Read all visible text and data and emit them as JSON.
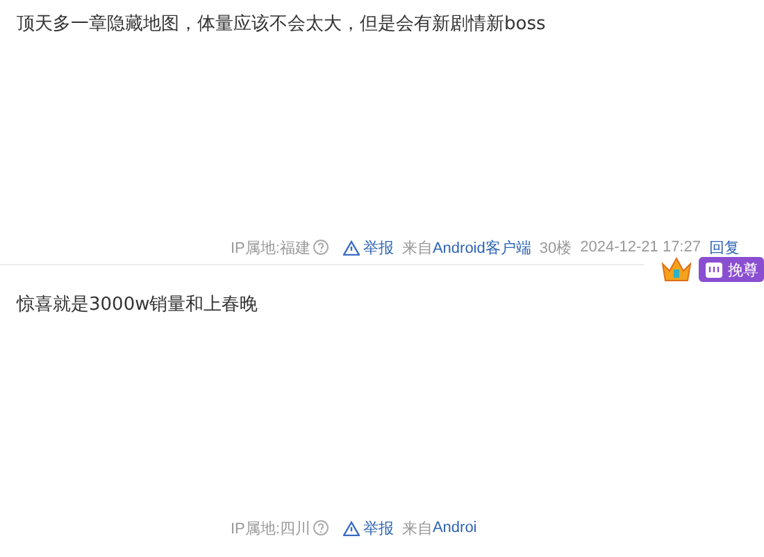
{
  "posts": [
    {
      "content": "顶天多一章隐藏地图，体量应该不会太大，但是会有新剧情新boss",
      "footer": {
        "ip_location": "IP属地:福建",
        "report": "举报",
        "source_prefix": "来自",
        "source_client": "Android客户端",
        "floor": "30楼",
        "time": "2024-12-21 17:27",
        "reply": "回复"
      }
    },
    {
      "content": "惊喜就是3000w销量和上春晚",
      "badge": {
        "label": "挽尊"
      },
      "footer": {
        "ip_location": "IP属地:四川",
        "report": "举报",
        "source_prefix": "来自",
        "source_client": "Androi"
      }
    }
  ]
}
